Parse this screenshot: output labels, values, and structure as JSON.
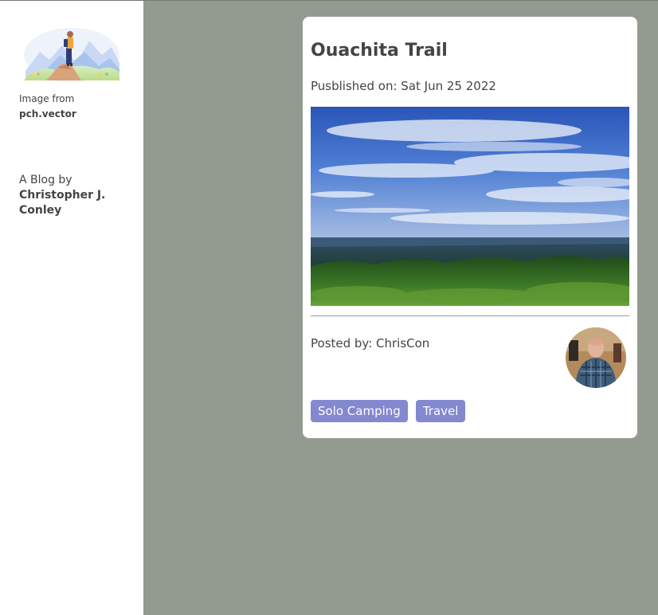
{
  "sidebar": {
    "illustration_icon": "hiker-on-mountain-illustration",
    "credit_prefix": "Image from",
    "credit_source": "pch.vector",
    "byline_prefix": "A Blog by",
    "byline_author": "Christopher J. Conley"
  },
  "post": {
    "title": "Ouachita Trail",
    "published": "Pusblished on: Sat Jun 25 2022",
    "photo_icon": "landscape-sky-forest-photo",
    "posted_by": "Posted by: ChrisCon",
    "avatar_icon": "author-avatar-photo",
    "tags": [
      "Solo Camping",
      "Travel"
    ]
  },
  "colors": {
    "page_background": "#939b8e",
    "sidebar_background": "#ffffff",
    "card_background": "#ffffff",
    "tag_background": "#8388cf",
    "text": "#444444"
  }
}
